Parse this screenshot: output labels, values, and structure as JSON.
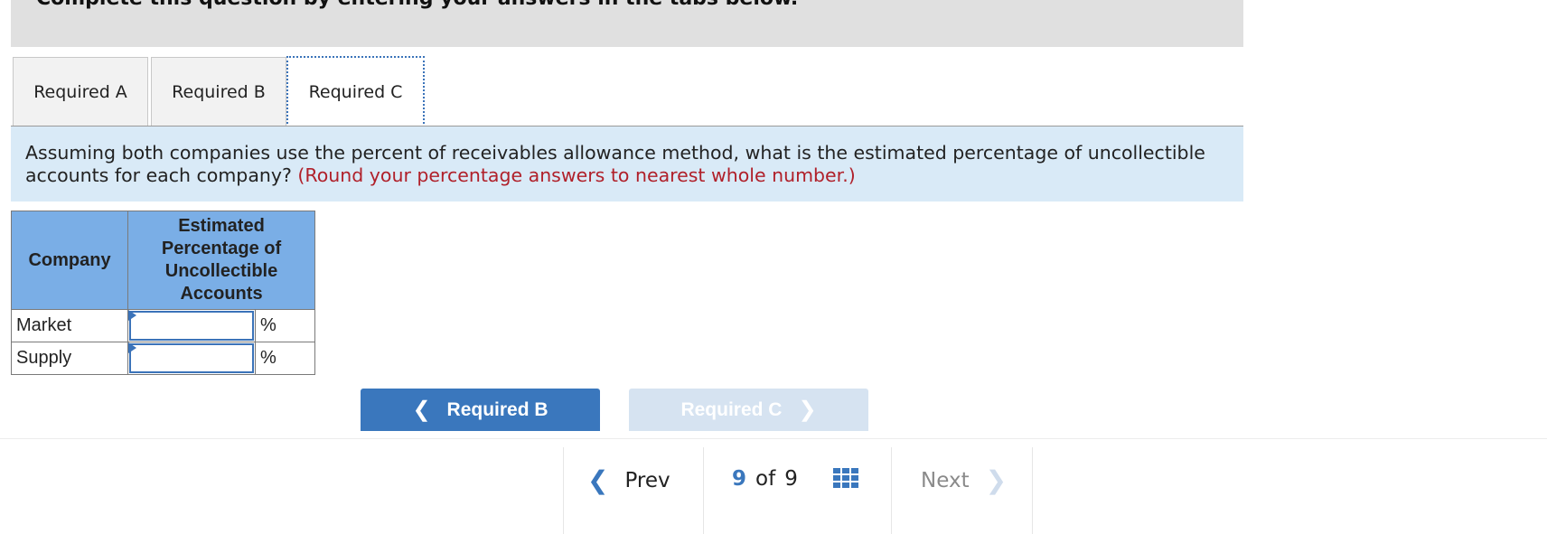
{
  "instructions": "Complete this question by entering your answers in the tabs below.",
  "tabs": [
    {
      "label": "Required A",
      "active": false
    },
    {
      "label": "Required B",
      "active": false
    },
    {
      "label": "Required C",
      "active": true
    }
  ],
  "prompt": {
    "text": "Assuming both companies use the percent of receivables allowance method, what is the estimated percentage of uncollectible accounts for each company?",
    "hint": "(Round your percentage answers to nearest whole number.)"
  },
  "table": {
    "headers": [
      "Company",
      "Estimated Percentage of Uncollectible Accounts"
    ],
    "rows": [
      {
        "company": "Market",
        "value": "",
        "unit": "%"
      },
      {
        "company": "Supply",
        "value": "",
        "unit": "%"
      }
    ]
  },
  "nav": {
    "prev_label": "Required B",
    "next_label": "Required C",
    "prev_icon": "chevron-left-icon",
    "next_icon": "chevron-right-icon"
  },
  "pager": {
    "prev_label": "Prev",
    "current": "9",
    "of_label": "of",
    "total": "9",
    "next_label": "Next"
  },
  "colors": {
    "accent": "#3a77bd",
    "header_fill": "#7aaee6",
    "prompt_bg": "#d9eaf7",
    "hint": "#b0202a",
    "disabled_button": "#d6e3f1"
  }
}
